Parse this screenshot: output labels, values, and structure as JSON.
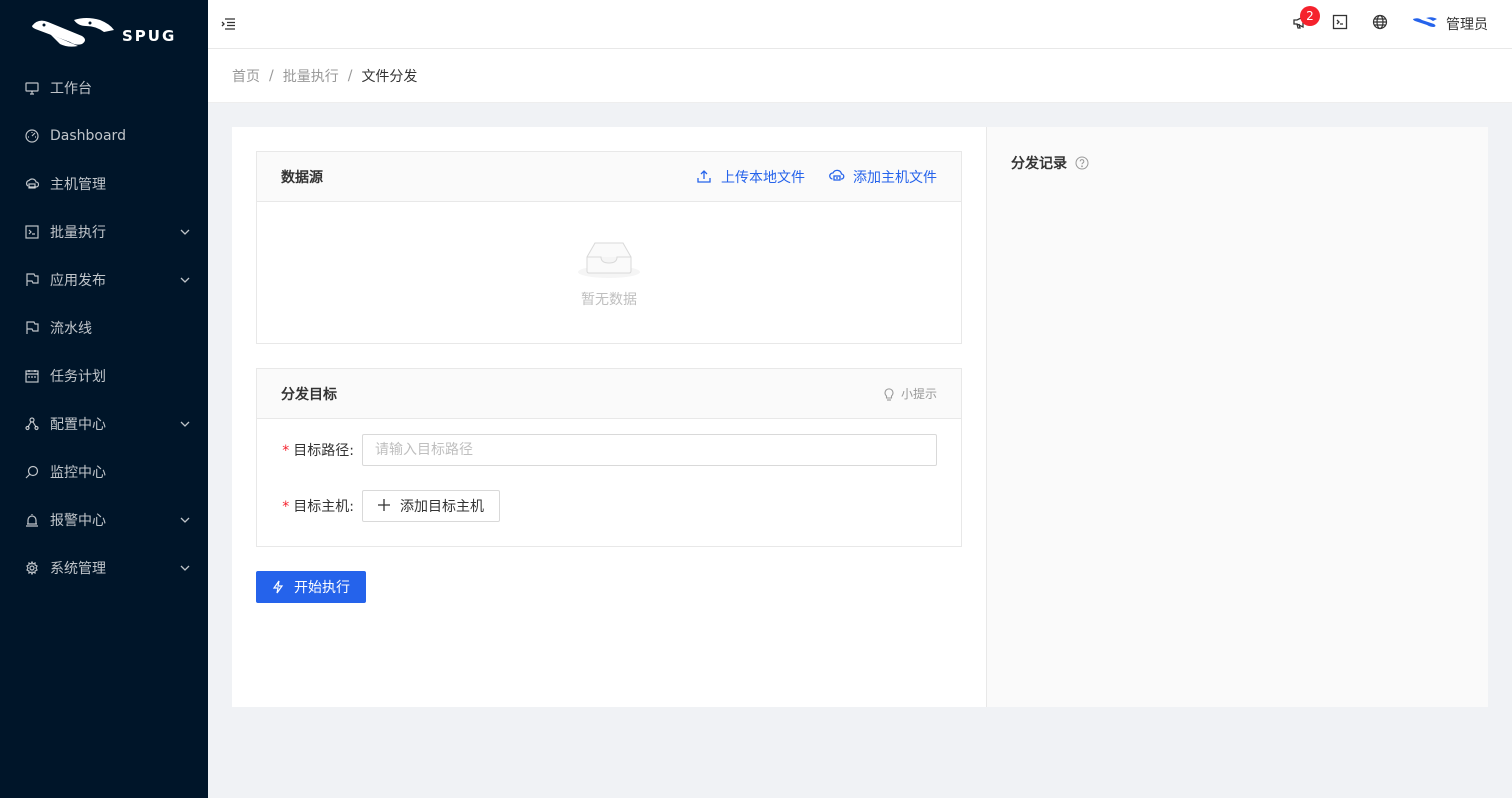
{
  "app": {
    "logo_text": "SPUG"
  },
  "sidebar": {
    "items": [
      {
        "label": "工作台",
        "icon": "desktop-icon",
        "expandable": false
      },
      {
        "label": "Dashboard",
        "icon": "dashboard-icon",
        "expandable": false
      },
      {
        "label": "主机管理",
        "icon": "cloud-server-icon",
        "expandable": false
      },
      {
        "label": "批量执行",
        "icon": "code-icon",
        "expandable": true
      },
      {
        "label": "应用发布",
        "icon": "flag-icon",
        "expandable": true
      },
      {
        "label": "流水线",
        "icon": "flag-icon",
        "expandable": false
      },
      {
        "label": "任务计划",
        "icon": "schedule-icon",
        "expandable": false
      },
      {
        "label": "配置中心",
        "icon": "deployment-icon",
        "expandable": true
      },
      {
        "label": "监控中心",
        "icon": "monitor-icon",
        "expandable": false
      },
      {
        "label": "报警中心",
        "icon": "alert-icon",
        "expandable": true
      },
      {
        "label": "系统管理",
        "icon": "setting-icon",
        "expandable": true
      }
    ]
  },
  "header": {
    "notification_count": "2",
    "user_name": "管理员"
  },
  "breadcrumb": {
    "items": [
      "首页",
      "批量执行",
      "文件分发"
    ]
  },
  "source_card": {
    "title": "数据源",
    "upload_local": "上传本地文件",
    "add_host_file": "添加主机文件",
    "empty_text": "暂无数据"
  },
  "target_card": {
    "title": "分发目标",
    "tip": "小提示",
    "path_label": "目标路径",
    "path_placeholder": "请输入目标路径",
    "host_label": "目标主机",
    "add_host_button": "添加目标主机"
  },
  "actions": {
    "start": "开始执行"
  },
  "aside": {
    "title": "分发记录"
  },
  "colors": {
    "primary": "#2563eb",
    "sidebar_bg": "#001529",
    "badge": "#f5222d"
  }
}
